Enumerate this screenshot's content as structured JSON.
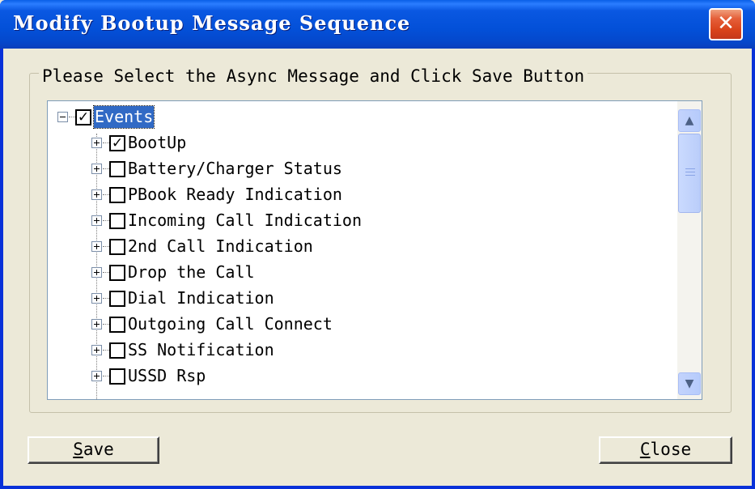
{
  "window": {
    "title": "Modify Bootup Message Sequence",
    "close_glyph": "✕"
  },
  "group": {
    "legend": "Please Select the Async Message and Click Save Button"
  },
  "tree": {
    "root": {
      "label": "Events",
      "checked": true,
      "expanded": true
    },
    "items": [
      {
        "label": "BootUp",
        "checked": true
      },
      {
        "label": "Battery/Charger Status",
        "checked": false
      },
      {
        "label": "PBook Ready Indication",
        "checked": false
      },
      {
        "label": "Incoming Call Indication",
        "checked": false
      },
      {
        "label": "2nd Call Indication",
        "checked": false
      },
      {
        "label": "Drop the Call",
        "checked": false
      },
      {
        "label": "Dial Indication",
        "checked": false
      },
      {
        "label": "Outgoing Call Connect",
        "checked": false
      },
      {
        "label": "SS Notification",
        "checked": false
      },
      {
        "label": "USSD Rsp",
        "checked": false
      }
    ],
    "scroll_up_glyph": "▲",
    "scroll_down_glyph": "▼"
  },
  "buttons": {
    "save_mnemonic": "S",
    "save_rest": "ave",
    "close_mnemonic": "C",
    "close_rest": "lose"
  },
  "colors": {
    "titlebar": "#0350d8",
    "selection": "#316ac5",
    "close_button": "#d9421a",
    "dialog_bg": "#ece9d8"
  }
}
